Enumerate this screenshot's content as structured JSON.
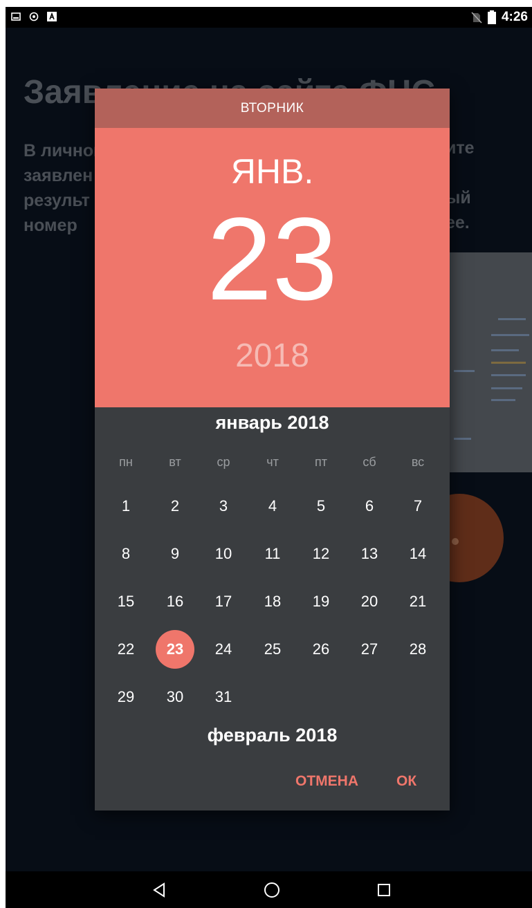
{
  "status_bar": {
    "time": "4:26",
    "icons_left": [
      "image-icon",
      "settings-circle-icon",
      "font-a-icon"
    ],
    "icons_right": [
      "no-sim-icon",
      "battery-icon"
    ]
  },
  "background": {
    "title": "Заявление на сайте ФНС",
    "paragraph_lines": [
      "В личном",
      "заявлен",
      "результ",
      "номер"
    ],
    "paragraph_right": [
      "ите",
      "ый",
      "ее."
    ]
  },
  "dialog": {
    "day_of_week": "ВТОРНИК",
    "month_short": "ЯНВ.",
    "day": "23",
    "year": "2018",
    "calendar_title": "январь 2018",
    "weekdays": [
      "пн",
      "вт",
      "ср",
      "чт",
      "пт",
      "сб",
      "вс"
    ],
    "weeks": [
      [
        "1",
        "2",
        "3",
        "4",
        "5",
        "6",
        "7"
      ],
      [
        "8",
        "9",
        "10",
        "11",
        "12",
        "13",
        "14"
      ],
      [
        "15",
        "16",
        "17",
        "18",
        "19",
        "20",
        "21"
      ],
      [
        "22",
        "23",
        "24",
        "25",
        "26",
        "27",
        "28"
      ],
      [
        "29",
        "30",
        "31",
        "",
        "",
        "",
        ""
      ]
    ],
    "selected_day": "23",
    "next_month_title": "февраль 2018",
    "cancel_label": "ОТМЕНА",
    "ok_label": "ОК"
  },
  "nav_bar": {
    "icons": [
      "back-icon",
      "home-icon",
      "recents-icon"
    ]
  },
  "colors": {
    "accent": "#ef766b",
    "header_dark": "#b3625a",
    "dialog_body": "#3a3d40"
  }
}
